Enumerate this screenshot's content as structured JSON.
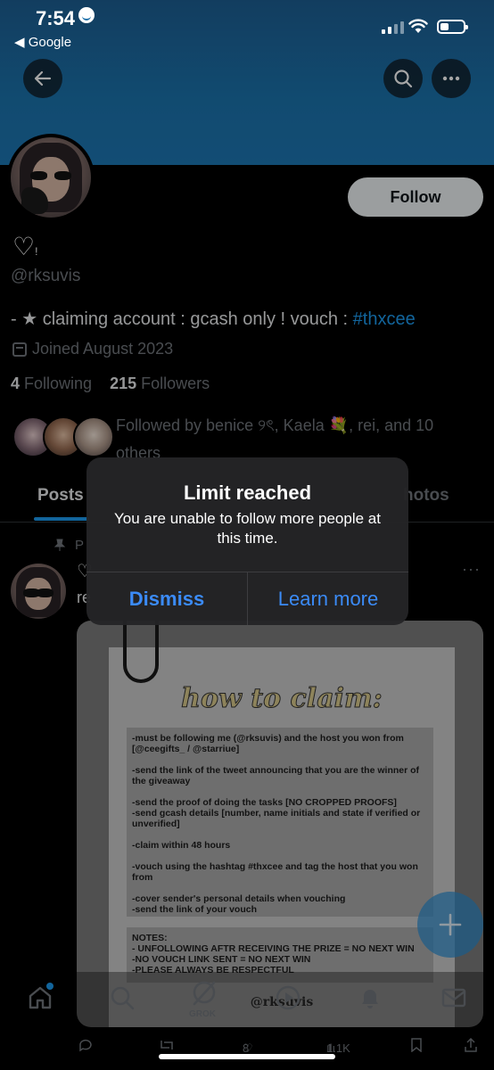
{
  "status_bar": {
    "time": "7:54",
    "back_app": "◀ Google"
  },
  "profile": {
    "follow_label": "Follow",
    "name": "♡",
    "name_suffix": "!",
    "handle": "@rksuvis",
    "bio_text": "- ★ claiming account : gcash only ! vouch : ",
    "bio_hashtag": "#thxcee",
    "joined": "Joined August 2023",
    "following_count": "4",
    "following_label": "Following",
    "followers_count": "215",
    "followers_label": "Followers",
    "followed_by": "Followed by benice ୨ৎ, Kaela 💐, rei, and 10 others"
  },
  "tabs": [
    {
      "label": "Posts"
    },
    {
      "label": "hotos"
    }
  ],
  "post": {
    "pinned_label": "P",
    "heart": "♡",
    "text_fragment": "re",
    "more": "···",
    "image": {
      "title": "how to claim:",
      "rules": [
        "-must be following me (@rksuvis) and the host you won from [@ceegifts_ / @starriue]",
        "-send the link of the tweet announcing that you are the winner of the giveaway",
        "-send the proof of doing the tasks [NO CROPPED PROOFS]",
        "-send gcash details [number, name initials and state if verified or unverified]",
        "-claim within 48 hours",
        "-vouch using the hashtag #thxcee and tag the host that you won from",
        "-cover sender's personal details when vouching",
        "-send the link of your vouch"
      ],
      "notes_title": "NOTES:",
      "notes": [
        " - UNFOLLOWING AFTR RECEIVING THE PRIZE = NO NEXT WIN",
        "-NO VOUCH LINK SENT = NO NEXT WIN",
        "-PLEASE ALWAYS BE RESPECTFUL"
      ],
      "handle": "@rksuvis"
    },
    "actions": {
      "likes": "8",
      "views": "1.1K"
    }
  },
  "bottom_nav": {
    "grok_label": "GROK"
  },
  "alert": {
    "title": "Limit reached",
    "message": "You are unable to follow more people at this time.",
    "dismiss_label": "Dismiss",
    "learn_more_label": "Learn more"
  },
  "colors": {
    "accent": "#1d9bf0",
    "banner": "#1b73ad",
    "alert_button": "#3b8bf7"
  }
}
